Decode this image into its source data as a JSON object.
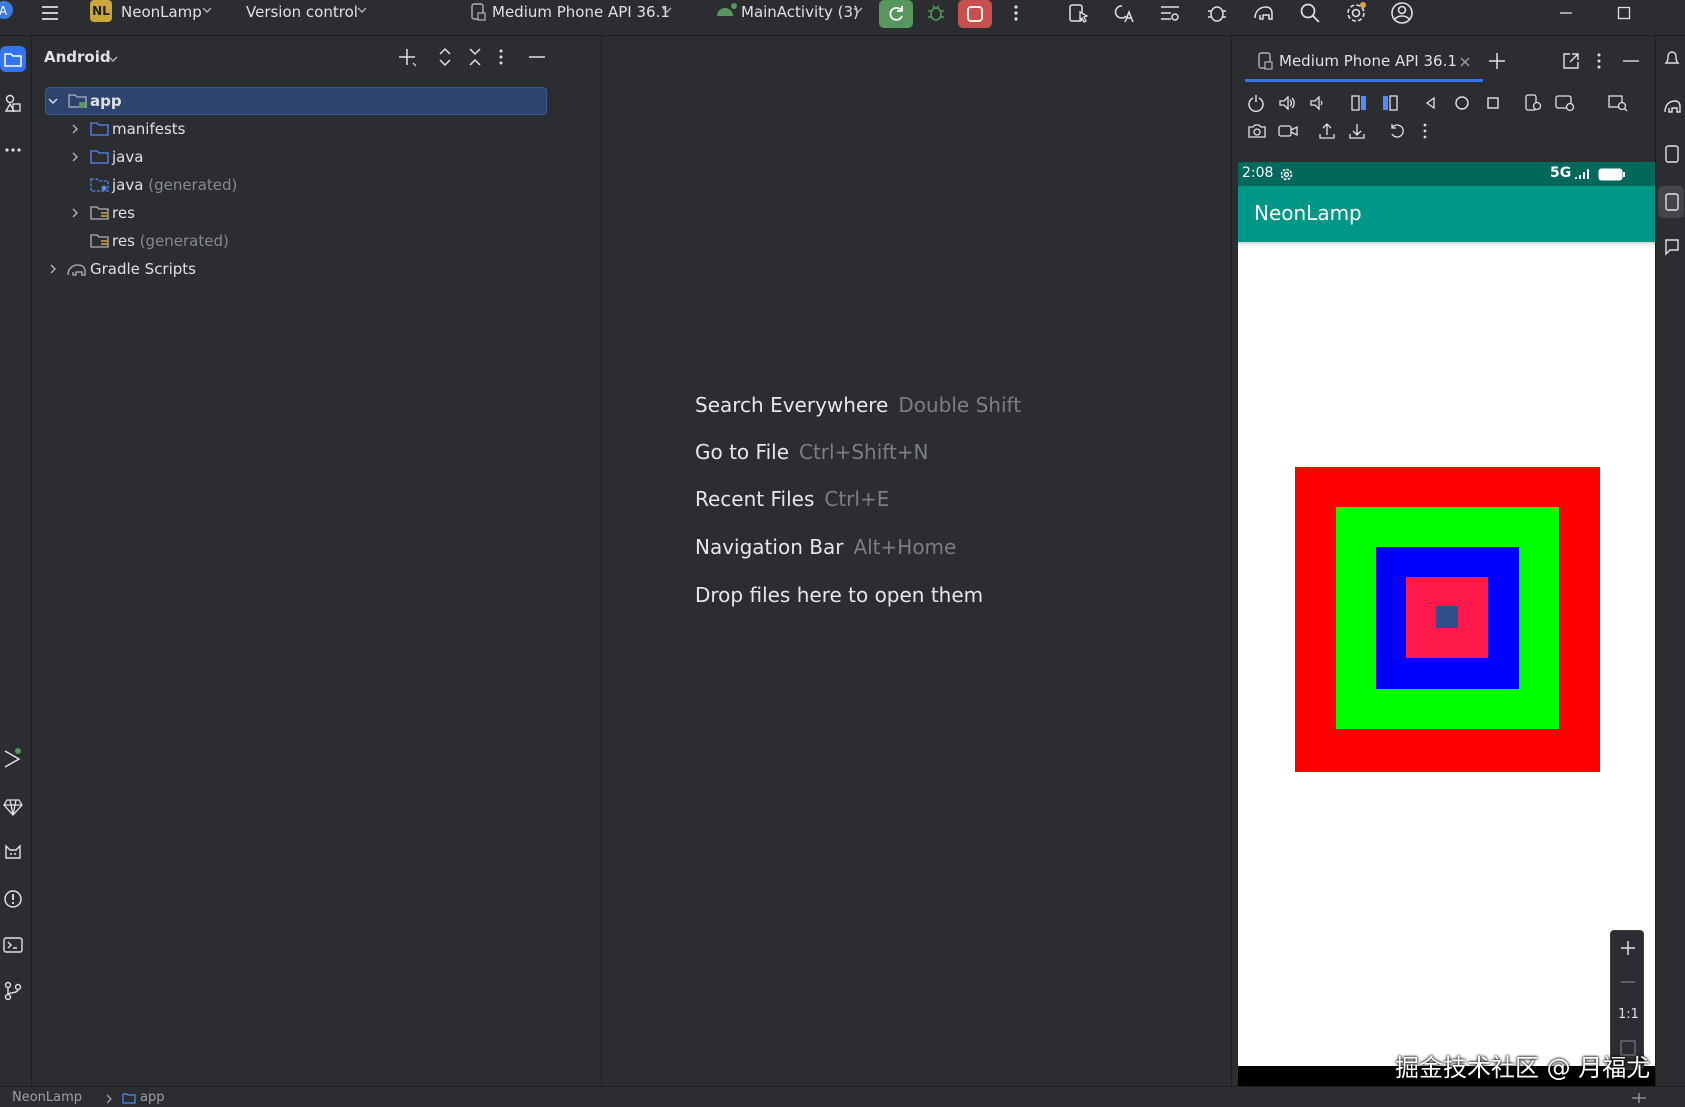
{
  "toolbar": {
    "project_badge": "NL",
    "project_name": "NeonLamp",
    "vcs_label": "Version control",
    "device_label": "Medium Phone API 36.1",
    "run_config_label": "MainActivity (3)"
  },
  "project_panel": {
    "view_selector": "Android",
    "tree": {
      "app": "app",
      "manifests": "manifests",
      "java": "java",
      "java_generated_name": "java",
      "java_generated_suffix": "(generated)",
      "res": "res",
      "res_generated_name": "res",
      "res_generated_suffix": "(generated)",
      "gradle_scripts": "Gradle Scripts"
    }
  },
  "editor_hints": [
    {
      "label": "Search Everywhere",
      "key": "Double Shift"
    },
    {
      "label": "Go to File",
      "key": "Ctrl+Shift+N"
    },
    {
      "label": "Recent Files",
      "key": "Ctrl+E"
    },
    {
      "label": "Navigation Bar",
      "key": "Alt+Home"
    },
    {
      "label": "Drop files here to open them",
      "key": ""
    }
  ],
  "device_panel": {
    "tab_label": "Medium Phone API 36.1",
    "phone": {
      "time": "2:08",
      "network": "5G",
      "app_title": "NeonLamp",
      "squares_colors": [
        "#ff0000",
        "#00ff00",
        "#0000ff",
        "#ff1a4b",
        "#2f4f8a"
      ],
      "background": "#ffffff",
      "app_bar_color": "#009688",
      "status_bar_color": "#00695c"
    },
    "zoom_ratio": "1:1"
  },
  "status_bar": {
    "breadcrumb_project": "NeonLamp",
    "breadcrumb_module": "app"
  },
  "watermark": "掘金技术社区 @ 月福尤",
  "colors": {
    "ide_background": "#2b2d30",
    "selection": "#2e436e",
    "run_button": "#57965c",
    "stop_button": "#c94f4f",
    "project_badge": "#c9a73c"
  }
}
